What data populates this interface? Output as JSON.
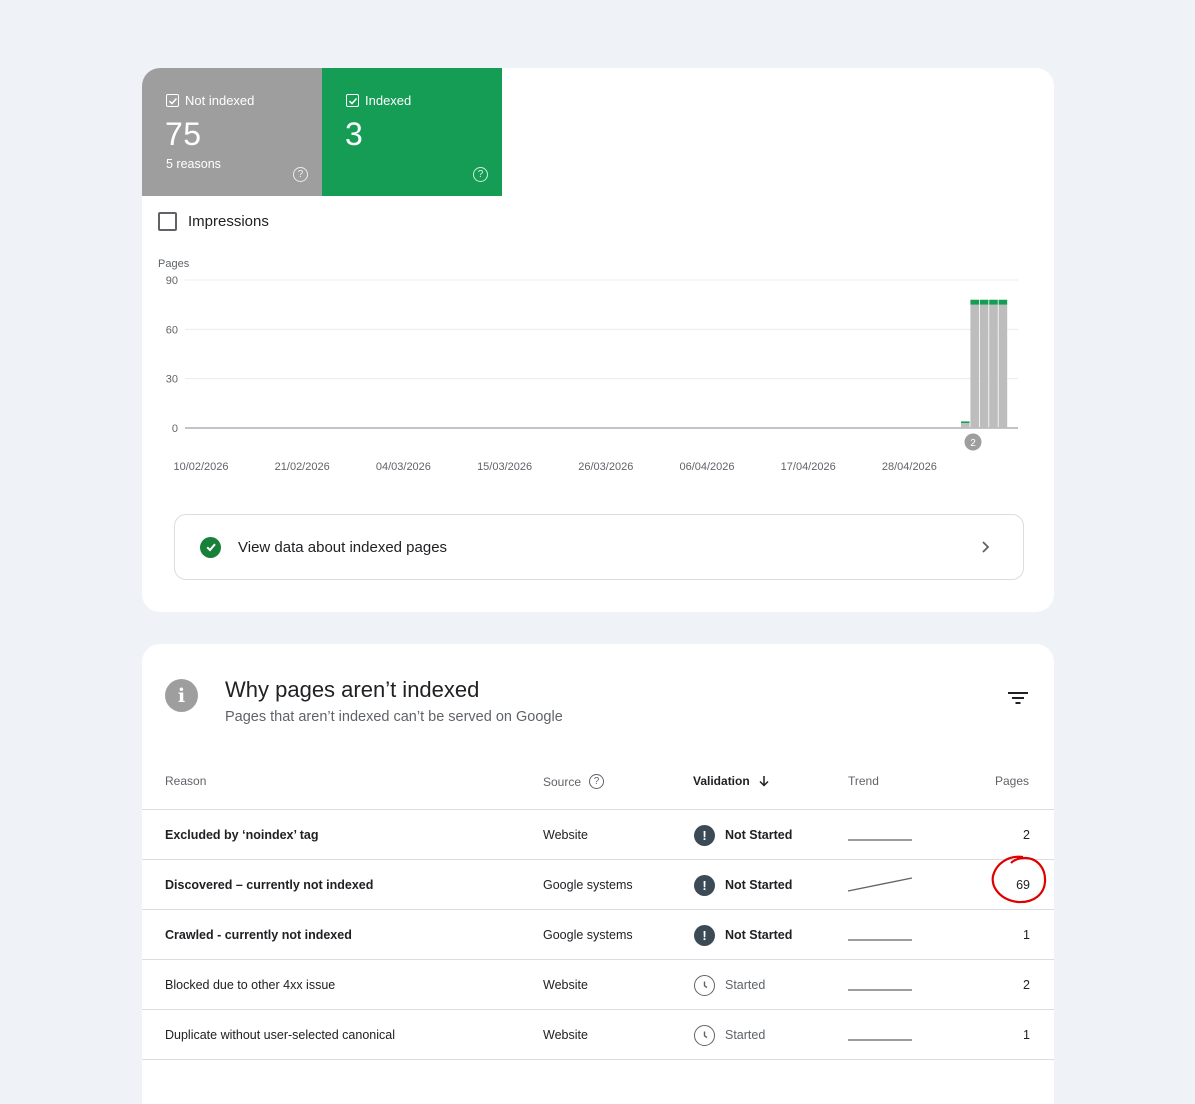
{
  "tiles": {
    "not_indexed": {
      "label": "Not indexed",
      "value": "75",
      "sub": "5 reasons",
      "help": "?"
    },
    "indexed": {
      "label": "Indexed",
      "value": "3",
      "help": "?"
    }
  },
  "impressions_label": "Impressions",
  "chart_data": {
    "type": "bar",
    "ylabel": "Pages",
    "ylim": [
      0,
      90
    ],
    "yticks": [
      "90",
      "60",
      "30",
      "0"
    ],
    "xticks": [
      "10/02/2026",
      "21/02/2026",
      "04/03/2026",
      "15/03/2026",
      "26/03/2026",
      "06/04/2026",
      "17/04/2026",
      "28/04/2026"
    ],
    "series": [
      {
        "name": "Not indexed",
        "color": "#bdbdbd",
        "values": [
          3,
          75,
          75,
          75,
          75
        ]
      },
      {
        "name": "Indexed",
        "color": "#169d55",
        "values": [
          1,
          3,
          3,
          3,
          3
        ]
      }
    ],
    "annotation": "2"
  },
  "view_data_label": "View data about indexed pages",
  "section": {
    "title": "Why pages aren’t indexed",
    "subtitle": "Pages that aren’t indexed can’t be served on Google",
    "columns": {
      "reason": "Reason",
      "source": "Source",
      "validation": "Validation",
      "trend": "Trend",
      "pages": "Pages"
    },
    "rows": [
      {
        "reason": "Excluded by ‘noindex’ tag",
        "source": "Website",
        "validation": "Not Started",
        "pages": "2"
      },
      {
        "reason": "Discovered – currently not indexed",
        "source": "Google systems",
        "validation": "Not Started",
        "pages": "69"
      },
      {
        "reason": "Crawled - currently not indexed",
        "source": "Google systems",
        "validation": "Not Started",
        "pages": "1"
      },
      {
        "reason": "Blocked due to other 4xx issue",
        "source": "Website",
        "validation": "Started",
        "pages": "2"
      },
      {
        "reason": "Duplicate without user-selected canonical",
        "source": "Website",
        "validation": "Started",
        "pages": "1"
      }
    ]
  },
  "colors": {
    "not_indexed": "#9e9e9e",
    "indexed": "#169d55",
    "annotation_circle": "#e00000"
  }
}
